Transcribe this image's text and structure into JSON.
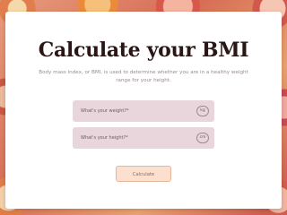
{
  "page": {
    "title": "Calculate your BMI",
    "subtitle": "Body mass index, or BMI, is used to determine whether you are in a healthy weight range for your height."
  },
  "form": {
    "weight": {
      "placeholder": "What's your weight?*",
      "unit": "kg"
    },
    "height": {
      "placeholder": "What's your height?*",
      "unit": "cm"
    },
    "submit_label": "Calculate"
  },
  "colors": {
    "title": "#2b1616",
    "field_bg": "#e8d6dc",
    "button_bg": "#fbe0cf",
    "button_border": "#e8b799"
  }
}
